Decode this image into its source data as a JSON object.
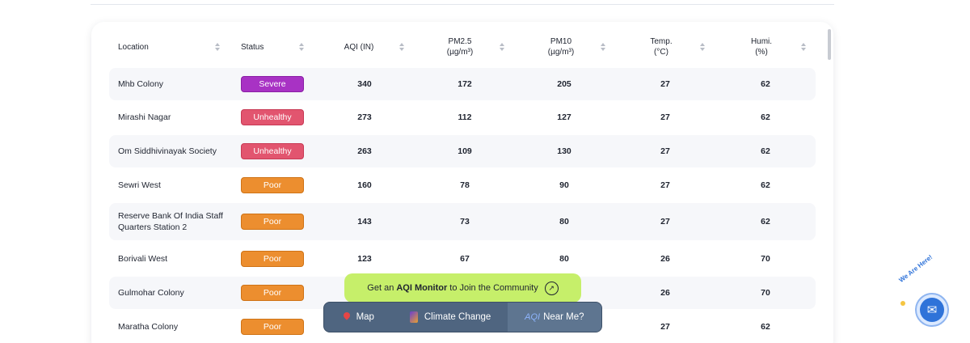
{
  "table": {
    "headers": [
      {
        "label": "Location",
        "sub": ""
      },
      {
        "label": "Status",
        "sub": ""
      },
      {
        "label": "AQI (IN)",
        "sub": ""
      },
      {
        "label": "PM2.5",
        "sub": "(µg/m³)"
      },
      {
        "label": "PM10",
        "sub": "(µg/m³)"
      },
      {
        "label": "Temp.",
        "sub": "(°C)"
      },
      {
        "label": "Humi.",
        "sub": "(%)"
      }
    ],
    "rows": [
      {
        "location": "Mhb Colony",
        "status": "Severe",
        "aqi": "340",
        "pm25": "172",
        "pm10": "205",
        "temp": "27",
        "humi": "62"
      },
      {
        "location": "Mirashi Nagar",
        "status": "Unhealthy",
        "aqi": "273",
        "pm25": "112",
        "pm10": "127",
        "temp": "27",
        "humi": "62"
      },
      {
        "location": "Om Siddhivinayak Society",
        "status": "Unhealthy",
        "aqi": "263",
        "pm25": "109",
        "pm10": "130",
        "temp": "27",
        "humi": "62"
      },
      {
        "location": "Sewri West",
        "status": "Poor",
        "aqi": "160",
        "pm25": "78",
        "pm10": "90",
        "temp": "27",
        "humi": "62"
      },
      {
        "location": "Reserve Bank Of India Staff Quarters Station 2",
        "status": "Poor",
        "aqi": "143",
        "pm25": "73",
        "pm10": "80",
        "temp": "27",
        "humi": "62"
      },
      {
        "location": "Borivali West",
        "status": "Poor",
        "aqi": "123",
        "pm25": "67",
        "pm10": "80",
        "temp": "26",
        "humi": "70"
      },
      {
        "location": "Gulmohar Colony",
        "status": "Poor",
        "aqi": "",
        "pm25": "",
        "pm10": "",
        "temp": "26",
        "humi": "70"
      },
      {
        "location": "Maratha Colony",
        "status": "Poor",
        "aqi": "",
        "pm25": "",
        "pm10": "",
        "temp": "27",
        "humi": "62"
      }
    ]
  },
  "cta": {
    "prefix": "Get an",
    "bold": "AQI Monitor",
    "suffix": "to Join the Community",
    "arrow": "↗"
  },
  "nav": {
    "map": "Map",
    "climate": "Climate Change",
    "near_icon": "AQI",
    "near": "Near Me?"
  },
  "helper": {
    "text": "We Are Here!",
    "icon": "✉"
  },
  "colors": {
    "severe": "#a832c4",
    "unhealthy": "#e2556f",
    "poor": "#ec8e2f",
    "cta_bg": "#c6ef6a",
    "nav_bg": "#4f6580"
  }
}
